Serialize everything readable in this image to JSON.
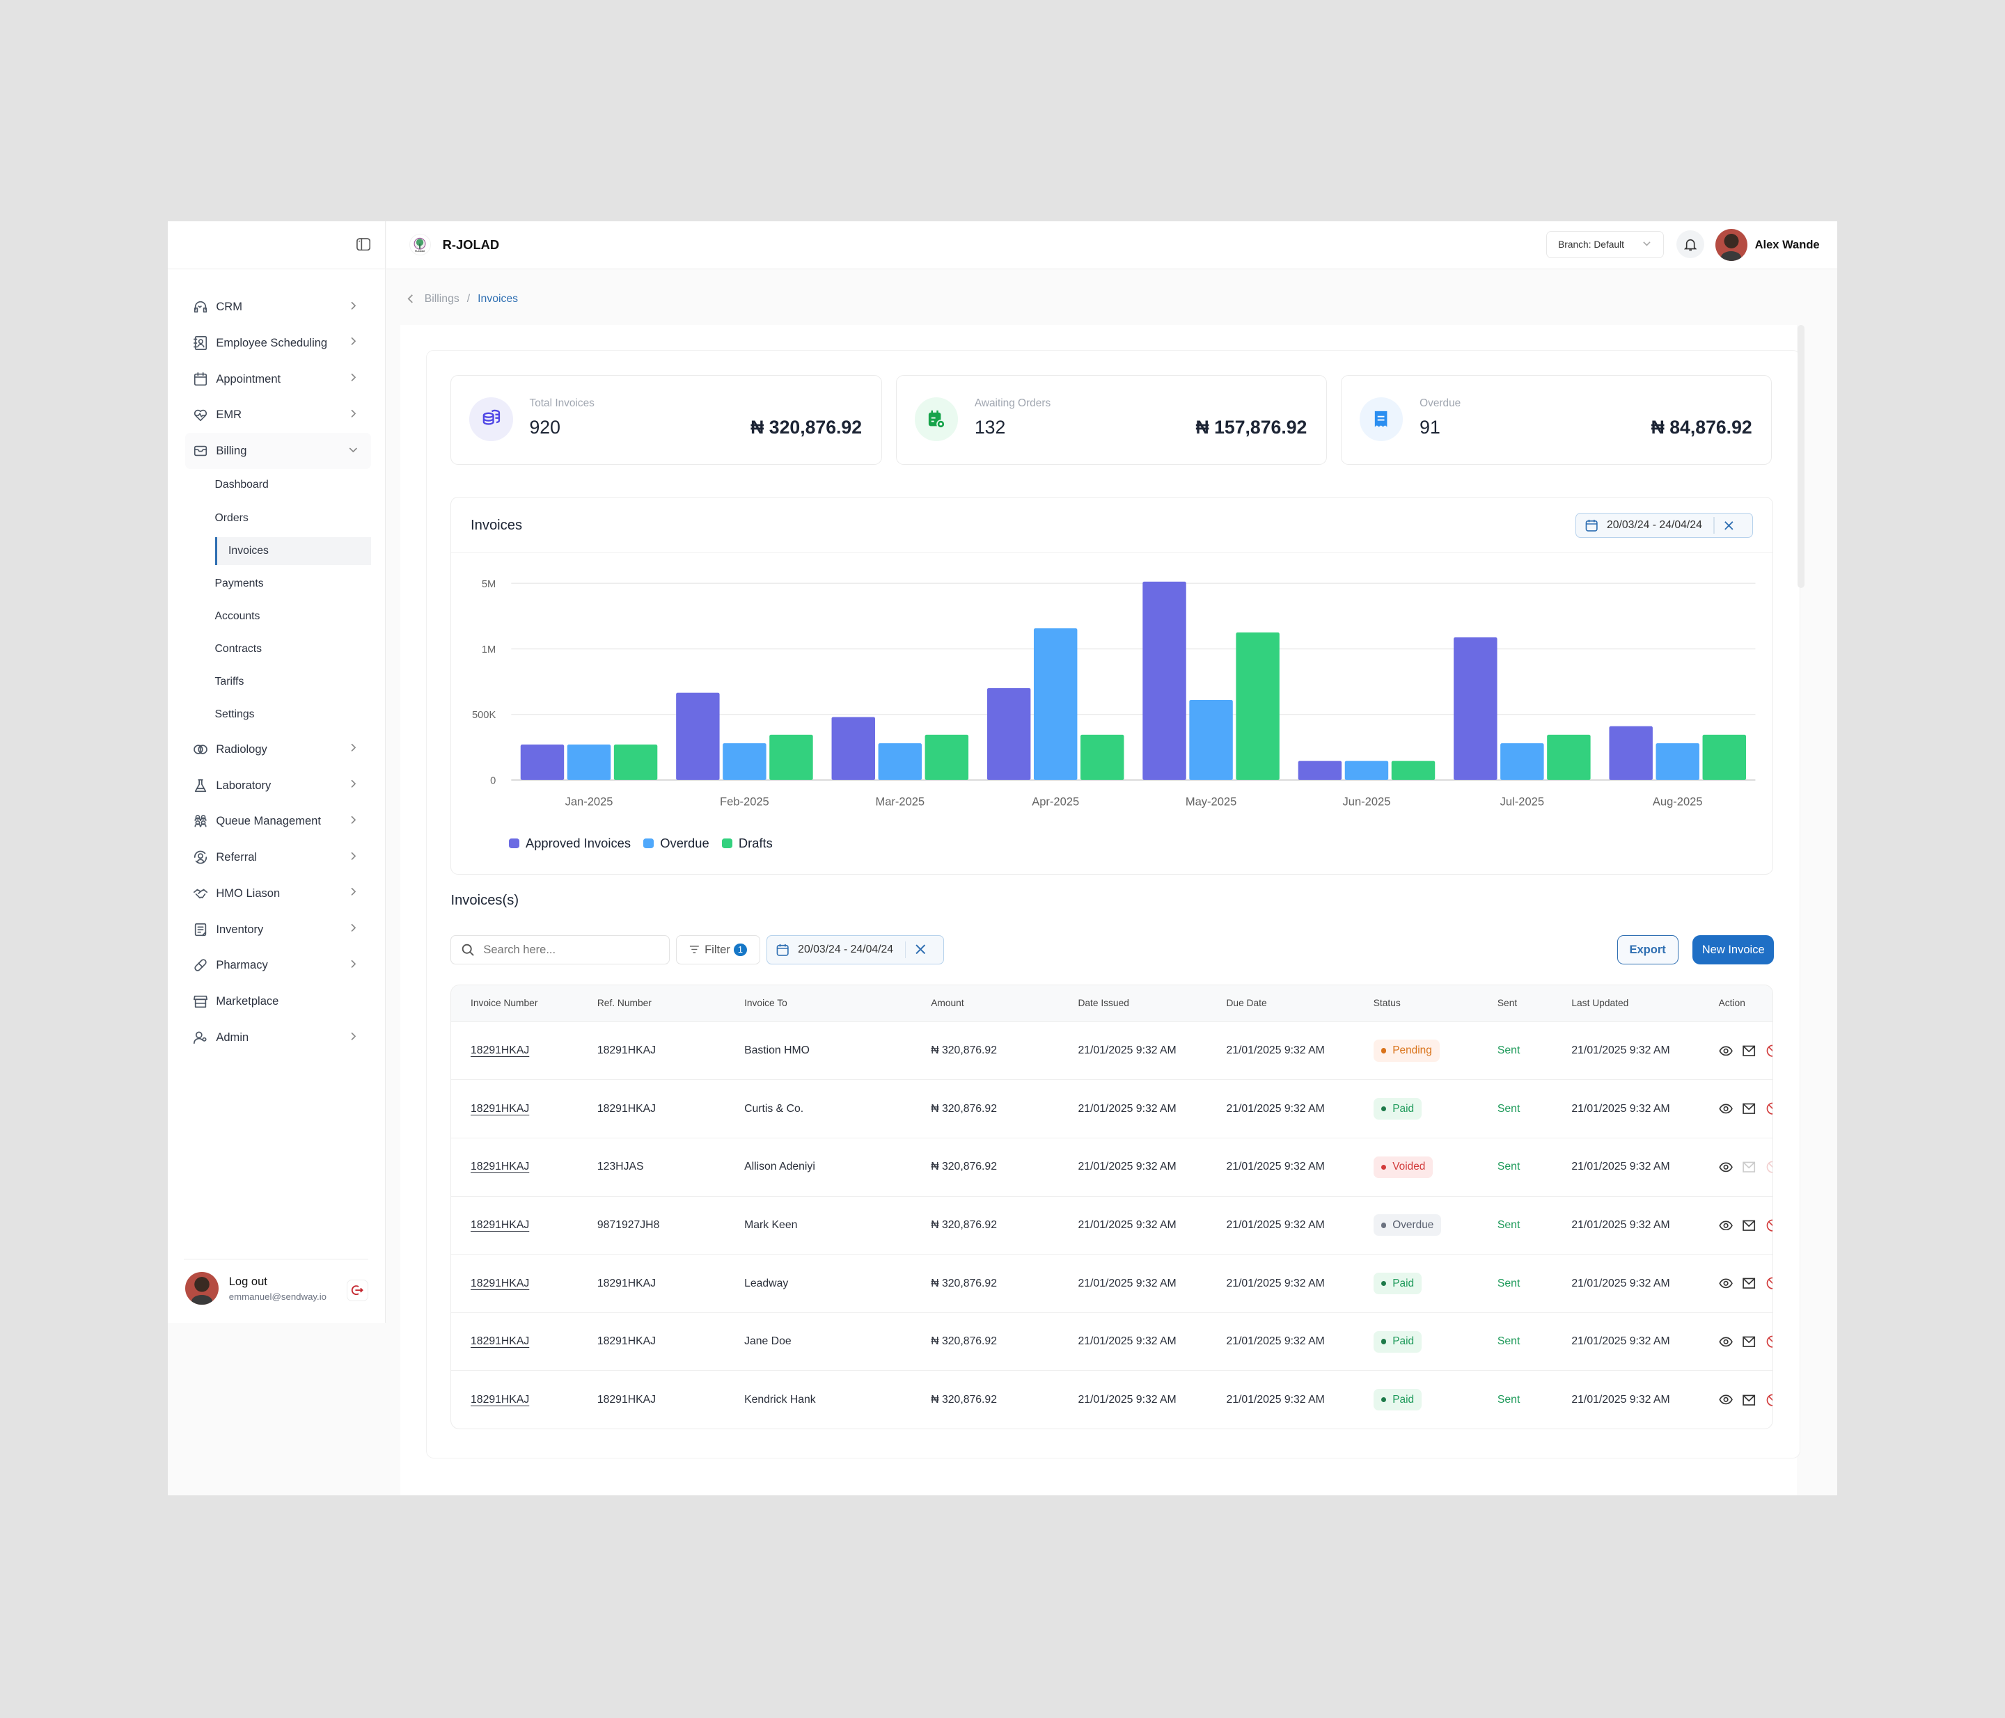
{
  "sidebar": {
    "items": [
      {
        "label": "CRM",
        "icon": "headset-icon"
      },
      {
        "label": "Employee Scheduling",
        "icon": "contact-book-icon"
      },
      {
        "label": "Appointment",
        "icon": "calendar-icon"
      },
      {
        "label": "EMR",
        "icon": "heart-pulse-icon"
      },
      {
        "label": "Billing",
        "icon": "billing-tray-icon",
        "expanded": true
      }
    ],
    "billing_sub": [
      "Dashboard",
      "Orders",
      "Invoices",
      "Payments",
      "Accounts",
      "Contracts",
      "Tariffs",
      "Settings"
    ],
    "active_sub": "Invoices",
    "items_after": [
      {
        "label": "Radiology",
        "icon": "brain-icon"
      },
      {
        "label": "Laboratory",
        "icon": "flask-icon"
      },
      {
        "label": "Queue Management",
        "icon": "users-group-icon"
      },
      {
        "label": "Referral",
        "icon": "user-sync-icon"
      },
      {
        "label": "HMO Liason",
        "icon": "handshake-icon"
      },
      {
        "label": "Inventory",
        "icon": "clipboard-icon"
      },
      {
        "label": "Pharmacy",
        "icon": "pill-icon"
      },
      {
        "label": "Marketplace",
        "icon": "store-icon",
        "no_chevron": true
      },
      {
        "label": "Admin",
        "icon": "user-settings-icon"
      }
    ],
    "footer": {
      "label": "Log out",
      "email": "emmanuel@sendway.io"
    }
  },
  "header": {
    "brand": "R-JOLAD",
    "logo_caption": "R-Jolad",
    "branch": "Branch: Default",
    "user_name": "Alex Wande"
  },
  "breadcrumb": {
    "parent": "Billings",
    "separator": "/",
    "current": "Invoices"
  },
  "stats": [
    {
      "label": "Total Invoices",
      "count": "920",
      "amount": "₦ 320,876.92",
      "icon": "coins-stack-icon",
      "color": "#4f46e5",
      "bg": "#eeeefb"
    },
    {
      "label": "Awaiting Orders",
      "count": "132",
      "amount": "₦ 157,876.92",
      "icon": "calendar-clock-icon",
      "color": "#16a34a",
      "bg": "#eafaf0"
    },
    {
      "label": "Overdue",
      "count": "91",
      "amount": "₦ 84,876.92",
      "icon": "receipt-icon",
      "color": "#2b8ef0",
      "bg": "#edf5fe"
    }
  ],
  "chart_section": {
    "title": "Invoices",
    "date_range": "20/03/24 - 24/04/24"
  },
  "chart_data": {
    "type": "bar",
    "title": "Invoices",
    "xlabel": "",
    "ylabel": "",
    "categories": [
      "Jan-2025",
      "Feb-2025",
      "Mar-2025",
      "Apr-2025",
      "May-2025",
      "Jun-2025",
      "Jul-2025",
      "Aug-2025"
    ],
    "series": [
      {
        "name": "Approved Invoices",
        "color": "#6b6be3",
        "values": [
          270000,
          665000,
          480000,
          700000,
          5100000,
          145000,
          1700000,
          410000
        ]
      },
      {
        "name": "Overdue",
        "color": "#4fa8fb",
        "values": [
          270000,
          280000,
          280000,
          2250000,
          610000,
          145000,
          280000,
          280000
        ]
      },
      {
        "name": "Drafts",
        "color": "#33d17e",
        "values": [
          270000,
          345000,
          345000,
          345000,
          2000000,
          145000,
          345000,
          345000
        ]
      }
    ],
    "y_ticks": [
      0,
      500000,
      1000000,
      5000000
    ],
    "y_tick_labels": [
      "0",
      "500K",
      "1M",
      "5M"
    ],
    "y_scale": "piecewise (ticks equally spaced)",
    "ylim": [
      0,
      5000000
    ],
    "grid": true,
    "legend": "bottom-left"
  },
  "list": {
    "title": "Invoices(s)",
    "search_placeholder": "Search here...",
    "filter_label": "Filter",
    "filter_count": "1",
    "date_range": "20/03/24 - 24/04/24",
    "export_label": "Export",
    "new_label": "New Invoice",
    "columns": [
      "Invoice Number",
      "Ref. Number",
      "Invoice To",
      "Amount",
      "Date Issued",
      "Due Date",
      "Status",
      "Sent",
      "Last Updated",
      "Action"
    ],
    "rows": [
      {
        "invoice": "18291HKAJ",
        "ref": "18291HKAJ",
        "to": "Bastion HMO",
        "amount": "₦ 320,876.92",
        "issued": "21/01/2025 9:32 AM",
        "due": "21/01/2025 9:32 AM",
        "status": "Pending",
        "sent": "Sent",
        "updated": "21/01/2025 9:32 AM",
        "actions_disabled": false
      },
      {
        "invoice": "18291HKAJ",
        "ref": "18291HKAJ",
        "to": "Curtis & Co.",
        "amount": "₦ 320,876.92",
        "issued": "21/01/2025 9:32 AM",
        "due": "21/01/2025 9:32 AM",
        "status": "Paid",
        "sent": "Sent",
        "updated": "21/01/2025 9:32 AM",
        "actions_disabled": false
      },
      {
        "invoice": "18291HKAJ",
        "ref": "123HJAS",
        "to": "Allison Adeniyi",
        "amount": "₦ 320,876.92",
        "issued": "21/01/2025 9:32 AM",
        "due": "21/01/2025 9:32 AM",
        "status": "Voided",
        "sent": "Sent",
        "updated": "21/01/2025 9:32 AM",
        "actions_disabled": true
      },
      {
        "invoice": "18291HKAJ",
        "ref": "9871927JH8",
        "to": "Mark Keen",
        "amount": "₦ 320,876.92",
        "issued": "21/01/2025 9:32 AM",
        "due": "21/01/2025 9:32 AM",
        "status": "Overdue",
        "sent": "Sent",
        "updated": "21/01/2025 9:32 AM",
        "actions_disabled": false
      },
      {
        "invoice": "18291HKAJ",
        "ref": "18291HKAJ",
        "to": "Leadway",
        "amount": "₦ 320,876.92",
        "issued": "21/01/2025 9:32 AM",
        "due": "21/01/2025 9:32 AM",
        "status": "Paid",
        "sent": "Sent",
        "updated": "21/01/2025 9:32 AM",
        "actions_disabled": false
      },
      {
        "invoice": "18291HKAJ",
        "ref": "18291HKAJ",
        "to": "Jane Doe",
        "amount": "₦ 320,876.92",
        "issued": "21/01/2025 9:32 AM",
        "due": "21/01/2025 9:32 AM",
        "status": "Paid",
        "sent": "Sent",
        "updated": "21/01/2025 9:32 AM",
        "actions_disabled": false
      },
      {
        "invoice": "18291HKAJ",
        "ref": "18291HKAJ",
        "to": "Kendrick Hank",
        "amount": "₦ 320,876.92",
        "issued": "21/01/2025 9:32 AM",
        "due": "21/01/2025 9:32 AM",
        "status": "Paid",
        "sent": "Sent",
        "updated": "21/01/2025 9:32 AM",
        "actions_disabled": false
      }
    ],
    "status_styles": {
      "Pending": {
        "fg": "#d9731a",
        "bg": "#fff1ea",
        "dot": "#d9731a"
      },
      "Paid": {
        "fg": "#1e9a5a",
        "bg": "#e8f8ee",
        "dot": "#1e7a4a"
      },
      "Voided": {
        "fg": "#d23b3b",
        "bg": "#fde9e9",
        "dot": "#d23b3b"
      },
      "Overdue": {
        "fg": "#5a6170",
        "bg": "#f0f2f5",
        "dot": "#6b7280"
      }
    }
  }
}
